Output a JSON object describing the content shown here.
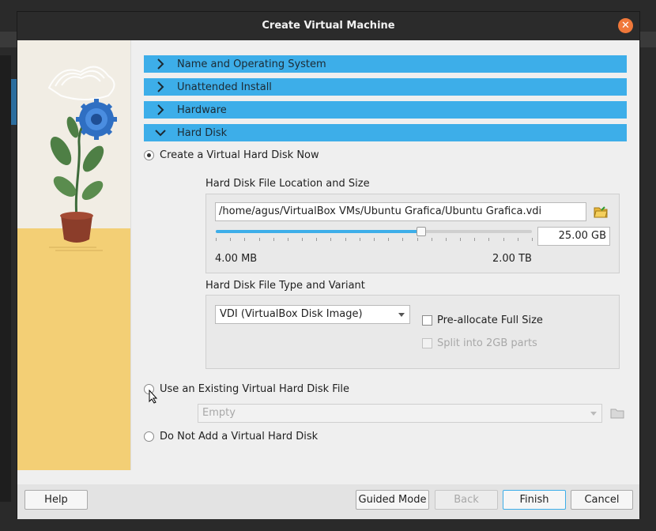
{
  "window": {
    "title": "Create Virtual Machine"
  },
  "sections": [
    {
      "label": "Name and Operating System",
      "expanded": false
    },
    {
      "label": "Unattended Install",
      "expanded": false
    },
    {
      "label": "Hardware",
      "expanded": false
    },
    {
      "label": "Hard Disk",
      "expanded": true
    }
  ],
  "hard_disk": {
    "option_create": {
      "label": "Create a Virtual Hard Disk Now",
      "checked": true
    },
    "location_group_label": "Hard Disk File Location and Size",
    "file_path": "/home/agus/VirtualBox VMs/Ubuntu Grafica/Ubuntu Grafica.vdi",
    "size_value": "25.00 GB",
    "size_min_label": "4.00 MB",
    "size_max_label": "2.00 TB",
    "size_slider_fraction": 0.65,
    "type_group_label": "Hard Disk File Type and Variant",
    "disk_type_selected": "VDI (VirtualBox Disk Image)",
    "preallocate_label": "Pre-allocate Full Size",
    "split_label": "Split into 2GB parts",
    "option_existing": {
      "label": "Use an Existing Virtual Hard Disk File",
      "checked": false
    },
    "existing_file_value": "Empty",
    "option_none": {
      "label": "Do Not Add a Virtual Hard Disk",
      "checked": false
    }
  },
  "footer": {
    "help": "Help",
    "guided_mode": "Guided Mode",
    "back": "Back",
    "finish": "Finish",
    "cancel": "Cancel"
  },
  "colors": {
    "accent": "#3daee9",
    "close": "#f0783a",
    "titlebar": "#2b2b2b"
  },
  "icons": {
    "section_collapsed": "chevron-right-icon",
    "section_expanded": "chevron-down-icon",
    "folder": "folder-open-icon",
    "close": "close-icon"
  }
}
